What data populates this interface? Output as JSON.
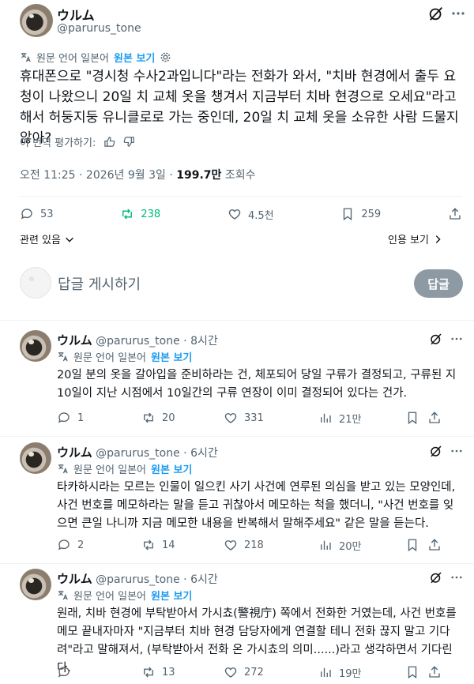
{
  "author": {
    "display_name": "ウルム",
    "handle": "@parurus_tone"
  },
  "translation": {
    "notice": "원문 언어 일본어",
    "view_original": "원본 보기",
    "rate": "이 번역 평가하기:"
  },
  "main_tweet": {
    "text": "휴대폰으로 \"경시청 수사2과입니다\"라는 전화가 와서, \"치바 현경에서 출두 요청이 나왔으니 20일 치 교체 옷을 챙겨서 지금부터 치바 현경으로 오세요\"라고 해서 허둥지둥 유니클로로 가는 중인데, 20일 치 교체 옷을 소유한 사람 드물지 않아?",
    "time": "오전 11:25 · 2026년 9월 3일 · ",
    "views_value": "199.7만",
    "views_label": " 조회수",
    "replies": "53",
    "reposts": "238",
    "likes": "4.5천",
    "bookmarks": "259",
    "relevant_label": "관련 있음",
    "quotes_label": "인용 보기"
  },
  "compose": {
    "placeholder": "답글 게시하기",
    "button": "답글"
  },
  "replies": [
    {
      "time": "· 8시간",
      "text": "20일 분의 옷을 갈아입을 준비하라는 건, 체포되어 당일 구류가 결정되고, 구류된 지 10일이 지난 시점에서 10일간의 구류 연장이 이미 결정되어 있다는 건가.",
      "replies": "1",
      "reposts": "20",
      "likes": "331",
      "views": "21만"
    },
    {
      "time": "· 6시간",
      "text": "타카하시라는 모르는 인물이 일으킨 사기 사건에 연루된 의심을 받고 있는 모양인데, 사건 번호를 메모하라는 말을 듣고 귀찮아서 메모하는 척을 했더니, \"사건 번호를 잊으면 큰일 나니까 지금 메모한 내용을 반복해서 말해주세요\" 같은 말을 듣는다.",
      "replies": "2",
      "reposts": "14",
      "likes": "218",
      "views": "20만"
    },
    {
      "time": "· 6시간",
      "text": "원래, 치바 현경에 부탁받아서 가시쵸(警視庁) 쪽에서 전화한 거였는데, 사건 번호를 메모 끝내자마자 \"지금부터 치바 현경 담당자에게 연결할 테니 전화 끊지 말고 기다려\"라고 말해져서, (부탁받아서 전화 온 가시쵸의 의미......)라고 생각하면서 기다린다.",
      "replies": "",
      "reposts": "13",
      "likes": "272",
      "views": "19만"
    }
  ]
}
